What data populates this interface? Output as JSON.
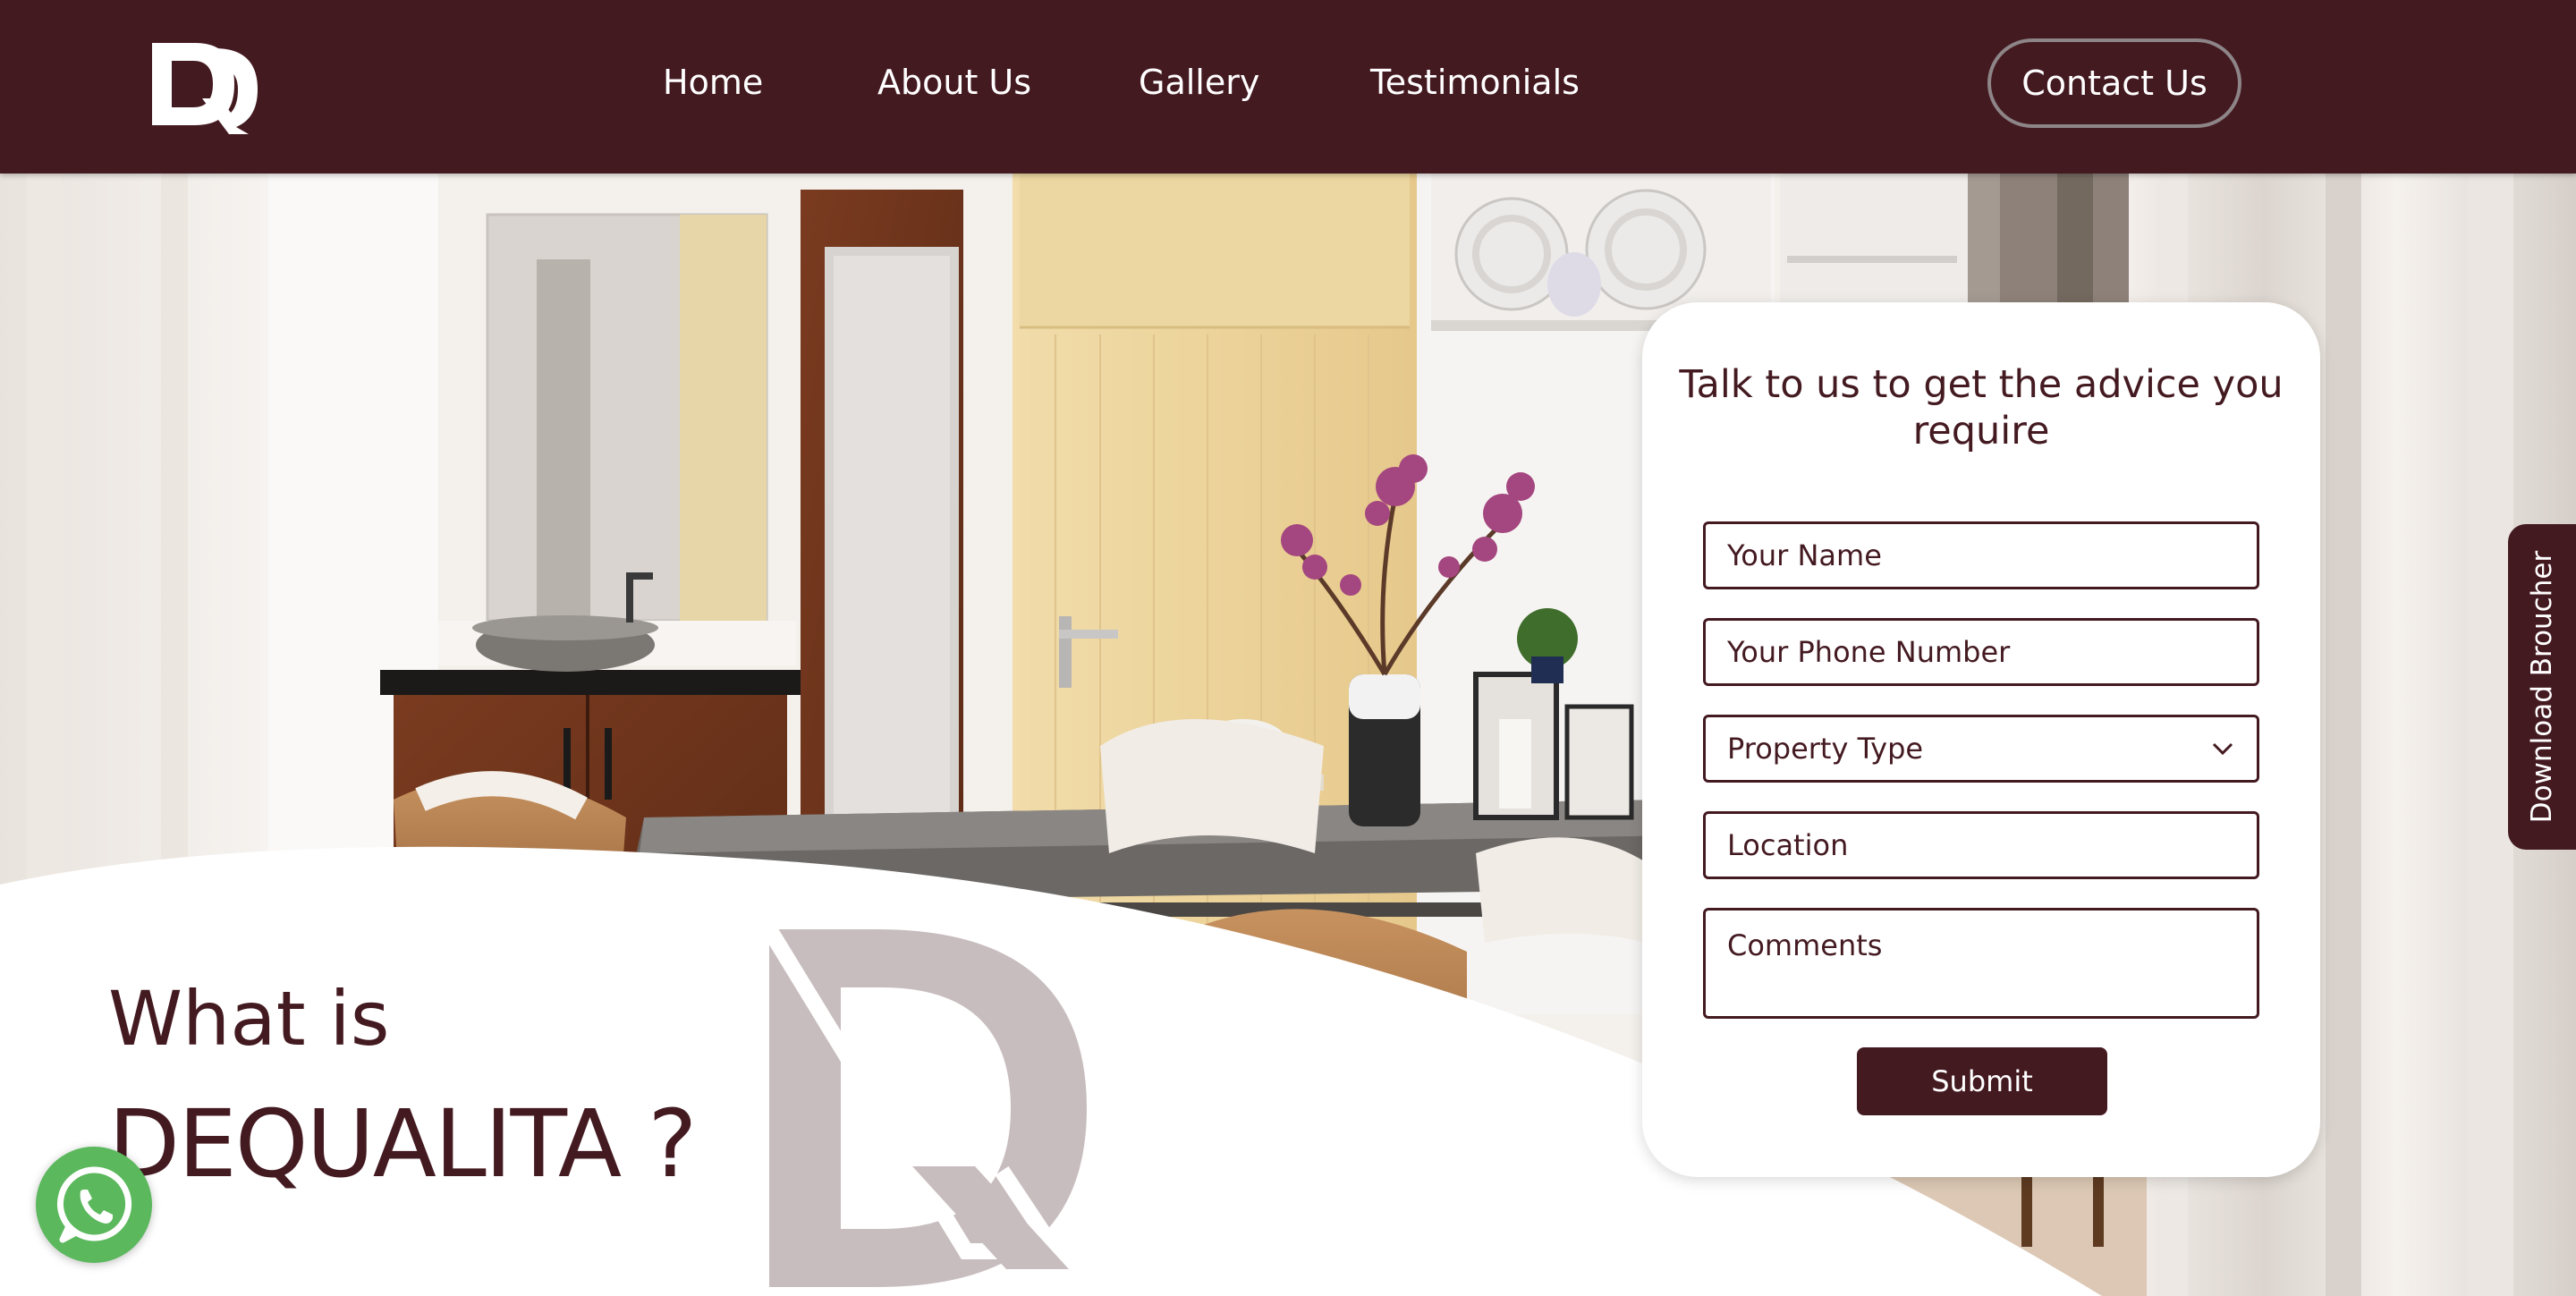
{
  "brand": {
    "logo_text": "DQ"
  },
  "nav": {
    "items": [
      {
        "label": "Home"
      },
      {
        "label": "About Us"
      },
      {
        "label": "Gallery"
      },
      {
        "label": "Testimonials"
      }
    ],
    "contact_label": "Contact Us"
  },
  "form": {
    "title": "Talk to us to get the advice you require",
    "name_placeholder": "Your Name",
    "phone_placeholder": "Your Phone Number",
    "property_type_value": "Property Type",
    "location_placeholder": "Location",
    "comments_placeholder": "Comments",
    "submit_label": "Submit"
  },
  "sidebar_tab": {
    "label": "Download Broucher"
  },
  "intro": {
    "line1": "What is",
    "line2": "DEQUALITA ?"
  },
  "icons": {
    "whatsapp": "whatsapp-icon",
    "dropdown": "chevron-down-icon"
  },
  "colors": {
    "brand": "#441a21",
    "whatsapp": "#5bb85c",
    "watermark": "#c3b6b8"
  }
}
